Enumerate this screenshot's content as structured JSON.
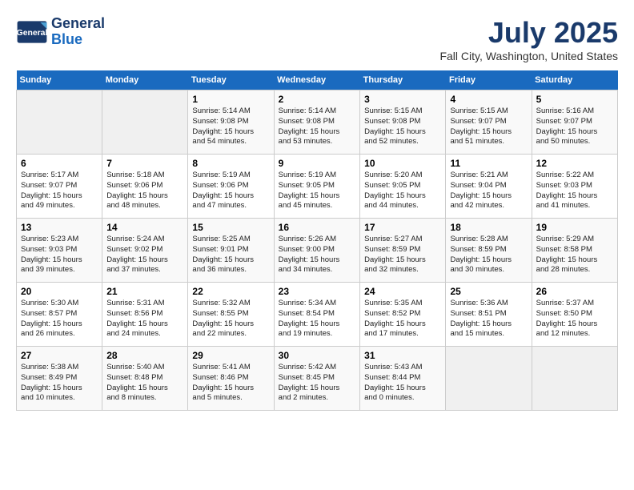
{
  "header": {
    "logo_line1": "General",
    "logo_line2": "Blue",
    "month": "July 2025",
    "location": "Fall City, Washington, United States"
  },
  "days_of_week": [
    "Sunday",
    "Monday",
    "Tuesday",
    "Wednesday",
    "Thursday",
    "Friday",
    "Saturday"
  ],
  "weeks": [
    [
      {
        "day": "",
        "info": ""
      },
      {
        "day": "",
        "info": ""
      },
      {
        "day": "1",
        "info": "Sunrise: 5:14 AM\nSunset: 9:08 PM\nDaylight: 15 hours\nand 54 minutes."
      },
      {
        "day": "2",
        "info": "Sunrise: 5:14 AM\nSunset: 9:08 PM\nDaylight: 15 hours\nand 53 minutes."
      },
      {
        "day": "3",
        "info": "Sunrise: 5:15 AM\nSunset: 9:08 PM\nDaylight: 15 hours\nand 52 minutes."
      },
      {
        "day": "4",
        "info": "Sunrise: 5:15 AM\nSunset: 9:07 PM\nDaylight: 15 hours\nand 51 minutes."
      },
      {
        "day": "5",
        "info": "Sunrise: 5:16 AM\nSunset: 9:07 PM\nDaylight: 15 hours\nand 50 minutes."
      }
    ],
    [
      {
        "day": "6",
        "info": "Sunrise: 5:17 AM\nSunset: 9:07 PM\nDaylight: 15 hours\nand 49 minutes."
      },
      {
        "day": "7",
        "info": "Sunrise: 5:18 AM\nSunset: 9:06 PM\nDaylight: 15 hours\nand 48 minutes."
      },
      {
        "day": "8",
        "info": "Sunrise: 5:19 AM\nSunset: 9:06 PM\nDaylight: 15 hours\nand 47 minutes."
      },
      {
        "day": "9",
        "info": "Sunrise: 5:19 AM\nSunset: 9:05 PM\nDaylight: 15 hours\nand 45 minutes."
      },
      {
        "day": "10",
        "info": "Sunrise: 5:20 AM\nSunset: 9:05 PM\nDaylight: 15 hours\nand 44 minutes."
      },
      {
        "day": "11",
        "info": "Sunrise: 5:21 AM\nSunset: 9:04 PM\nDaylight: 15 hours\nand 42 minutes."
      },
      {
        "day": "12",
        "info": "Sunrise: 5:22 AM\nSunset: 9:03 PM\nDaylight: 15 hours\nand 41 minutes."
      }
    ],
    [
      {
        "day": "13",
        "info": "Sunrise: 5:23 AM\nSunset: 9:03 PM\nDaylight: 15 hours\nand 39 minutes."
      },
      {
        "day": "14",
        "info": "Sunrise: 5:24 AM\nSunset: 9:02 PM\nDaylight: 15 hours\nand 37 minutes."
      },
      {
        "day": "15",
        "info": "Sunrise: 5:25 AM\nSunset: 9:01 PM\nDaylight: 15 hours\nand 36 minutes."
      },
      {
        "day": "16",
        "info": "Sunrise: 5:26 AM\nSunset: 9:00 PM\nDaylight: 15 hours\nand 34 minutes."
      },
      {
        "day": "17",
        "info": "Sunrise: 5:27 AM\nSunset: 8:59 PM\nDaylight: 15 hours\nand 32 minutes."
      },
      {
        "day": "18",
        "info": "Sunrise: 5:28 AM\nSunset: 8:59 PM\nDaylight: 15 hours\nand 30 minutes."
      },
      {
        "day": "19",
        "info": "Sunrise: 5:29 AM\nSunset: 8:58 PM\nDaylight: 15 hours\nand 28 minutes."
      }
    ],
    [
      {
        "day": "20",
        "info": "Sunrise: 5:30 AM\nSunset: 8:57 PM\nDaylight: 15 hours\nand 26 minutes."
      },
      {
        "day": "21",
        "info": "Sunrise: 5:31 AM\nSunset: 8:56 PM\nDaylight: 15 hours\nand 24 minutes."
      },
      {
        "day": "22",
        "info": "Sunrise: 5:32 AM\nSunset: 8:55 PM\nDaylight: 15 hours\nand 22 minutes."
      },
      {
        "day": "23",
        "info": "Sunrise: 5:34 AM\nSunset: 8:54 PM\nDaylight: 15 hours\nand 19 minutes."
      },
      {
        "day": "24",
        "info": "Sunrise: 5:35 AM\nSunset: 8:52 PM\nDaylight: 15 hours\nand 17 minutes."
      },
      {
        "day": "25",
        "info": "Sunrise: 5:36 AM\nSunset: 8:51 PM\nDaylight: 15 hours\nand 15 minutes."
      },
      {
        "day": "26",
        "info": "Sunrise: 5:37 AM\nSunset: 8:50 PM\nDaylight: 15 hours\nand 12 minutes."
      }
    ],
    [
      {
        "day": "27",
        "info": "Sunrise: 5:38 AM\nSunset: 8:49 PM\nDaylight: 15 hours\nand 10 minutes."
      },
      {
        "day": "28",
        "info": "Sunrise: 5:40 AM\nSunset: 8:48 PM\nDaylight: 15 hours\nand 8 minutes."
      },
      {
        "day": "29",
        "info": "Sunrise: 5:41 AM\nSunset: 8:46 PM\nDaylight: 15 hours\nand 5 minutes."
      },
      {
        "day": "30",
        "info": "Sunrise: 5:42 AM\nSunset: 8:45 PM\nDaylight: 15 hours\nand 2 minutes."
      },
      {
        "day": "31",
        "info": "Sunrise: 5:43 AM\nSunset: 8:44 PM\nDaylight: 15 hours\nand 0 minutes."
      },
      {
        "day": "",
        "info": ""
      },
      {
        "day": "",
        "info": ""
      }
    ]
  ]
}
